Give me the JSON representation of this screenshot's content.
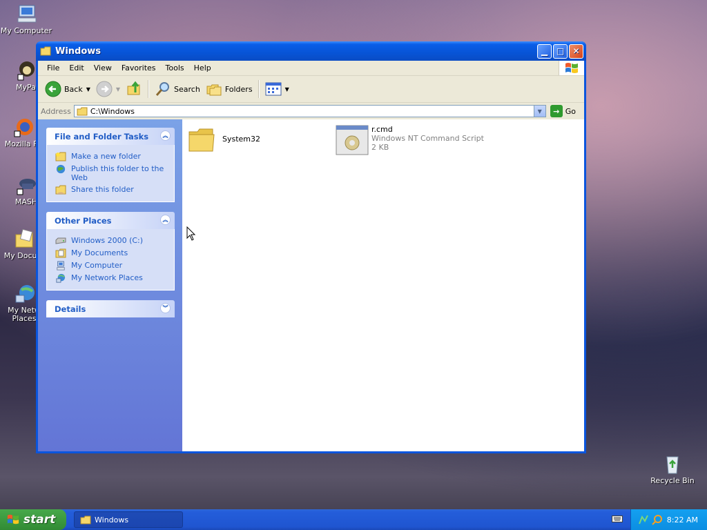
{
  "desktop": {
    "icons": [
      {
        "label": "My Computer",
        "icon": "computer-icon"
      },
      {
        "label": "MyPal",
        "icon": "mypal-icon"
      },
      {
        "label": "Mozilla Fir",
        "icon": "firefox-icon"
      },
      {
        "label": "MASH",
        "icon": "mash-icon"
      },
      {
        "label": "My Docum",
        "icon": "documents-icon"
      },
      {
        "label": "My Netw Places",
        "icon": "network-places-icon"
      },
      {
        "label": "Recycle Bin",
        "icon": "recycle-bin-icon"
      }
    ]
  },
  "window": {
    "title": "Windows",
    "menu": [
      "File",
      "Edit",
      "View",
      "Favorites",
      "Tools",
      "Help"
    ],
    "toolbar": {
      "back": "Back",
      "search": "Search",
      "folders": "Folders"
    },
    "address": {
      "label": "Address",
      "value": "C:\\Windows",
      "go": "Go"
    },
    "tasks": {
      "file_folder": {
        "title": "File and Folder Tasks",
        "items": [
          "Make a new folder",
          "Publish this folder to the Web",
          "Share this folder"
        ]
      },
      "other_places": {
        "title": "Other Places",
        "items": [
          "Windows 2000 (C:)",
          "My Documents",
          "My Computer",
          "My Network Places"
        ]
      },
      "details": {
        "title": "Details"
      }
    },
    "files": [
      {
        "name": "System32",
        "type": "",
        "size": ""
      },
      {
        "name": "r.cmd",
        "type": "Windows NT Command Script",
        "size": "2 KB"
      }
    ]
  },
  "taskbar": {
    "start": "start",
    "task": "Windows",
    "clock": "8:22 AM"
  },
  "colors": {
    "title_blue": "#0a5ee8",
    "taskpane_link": "#215dc6",
    "start_green": "#3c9a3f"
  }
}
